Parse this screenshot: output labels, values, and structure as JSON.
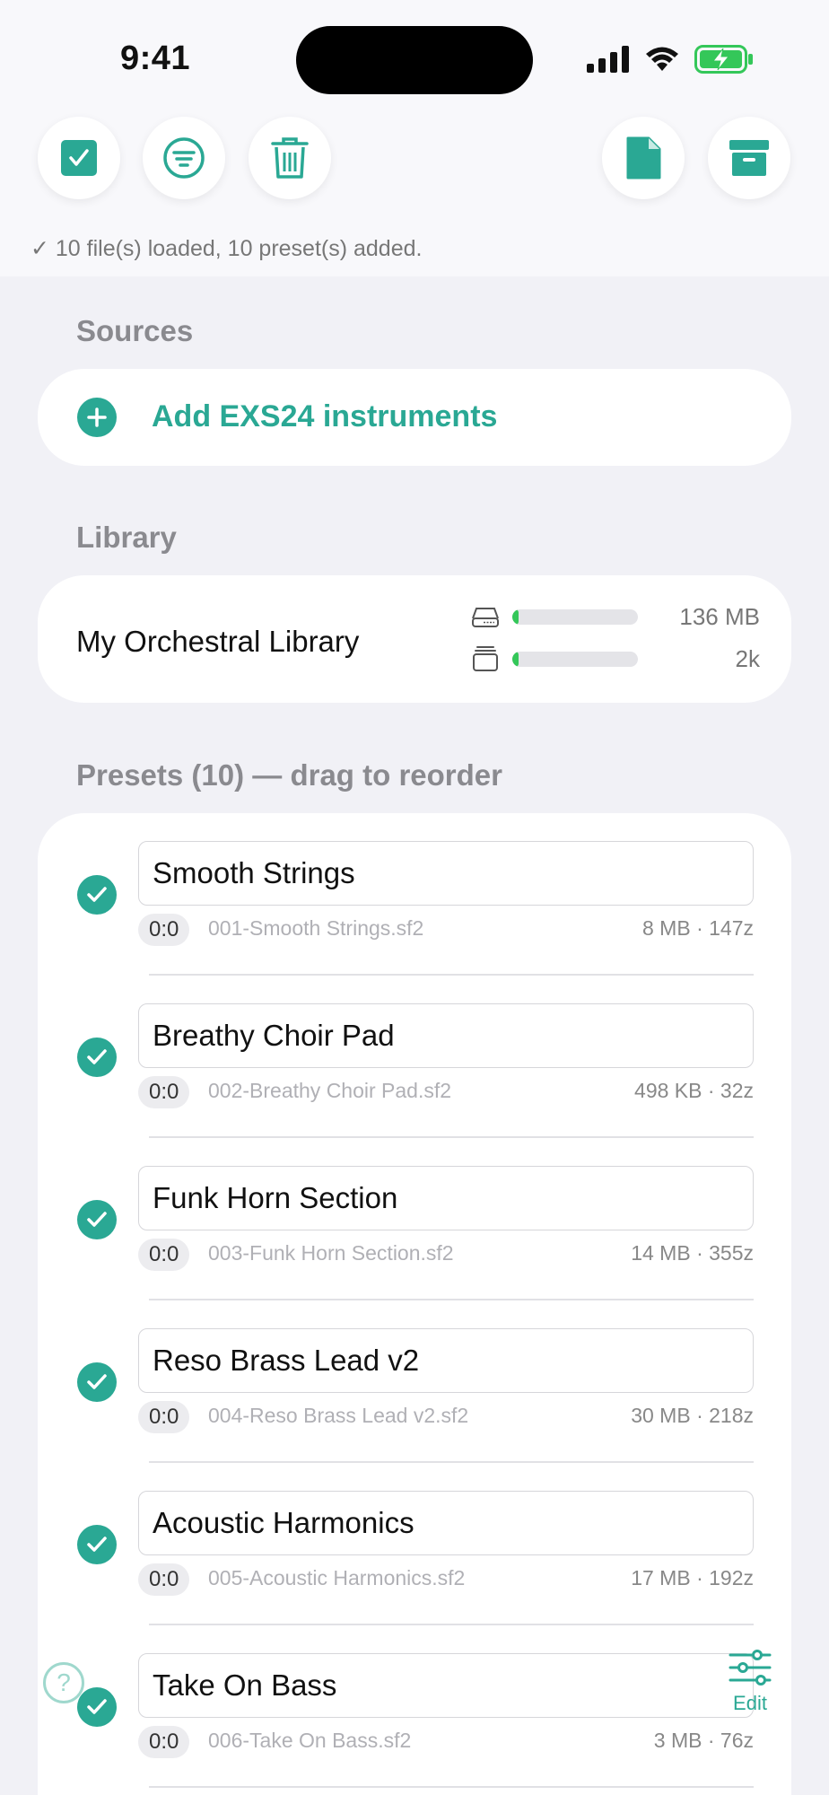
{
  "status_bar": {
    "time": "9:41"
  },
  "toolbar": {
    "select_icon": "checkbox-icon",
    "filter_icon": "filter-icon",
    "trash_icon": "trash-icon",
    "document_icon": "document-icon",
    "archive_icon": "archive-icon"
  },
  "status_message": "✓ 10 file(s) loaded, 10 preset(s) added.",
  "sources": {
    "title": "Sources",
    "add_label": "Add EXS24 instruments"
  },
  "library": {
    "title": "Library",
    "name": "My Orchestral Library",
    "size_value": "136 MB",
    "size_fill": 0.05,
    "count_value": "2k",
    "count_fill": 0.05
  },
  "presets": {
    "title": "Presets (10) — drag to reorder",
    "items": [
      {
        "name": "Smooth Strings",
        "coord": "0:0",
        "file": "001-Smooth Strings.sf2",
        "meta": "8 MB · 147z"
      },
      {
        "name": "Breathy Choir Pad",
        "coord": "0:0",
        "file": "002-Breathy Choir Pad.sf2",
        "meta": "498 KB · 32z"
      },
      {
        "name": "Funk Horn Section",
        "coord": "0:0",
        "file": "003-Funk Horn Section.sf2",
        "meta": "14 MB · 355z"
      },
      {
        "name": "Reso Brass Lead v2",
        "coord": "0:0",
        "file": "004-Reso Brass Lead v2.sf2",
        "meta": "30 MB · 218z"
      },
      {
        "name": "Acoustic Harmonics",
        "coord": "0:0",
        "file": "005-Acoustic Harmonics.sf2",
        "meta": "17 MB · 192z"
      },
      {
        "name": "Take On Bass",
        "coord": "0:0",
        "file": "006-Take On Bass.sf2",
        "meta": "3 MB · 76z"
      }
    ]
  },
  "help_label": "?",
  "edit_label": "Edit",
  "colors": {
    "accent": "#2aa894",
    "meter": "#34c759",
    "background": "#f1f1f6"
  }
}
